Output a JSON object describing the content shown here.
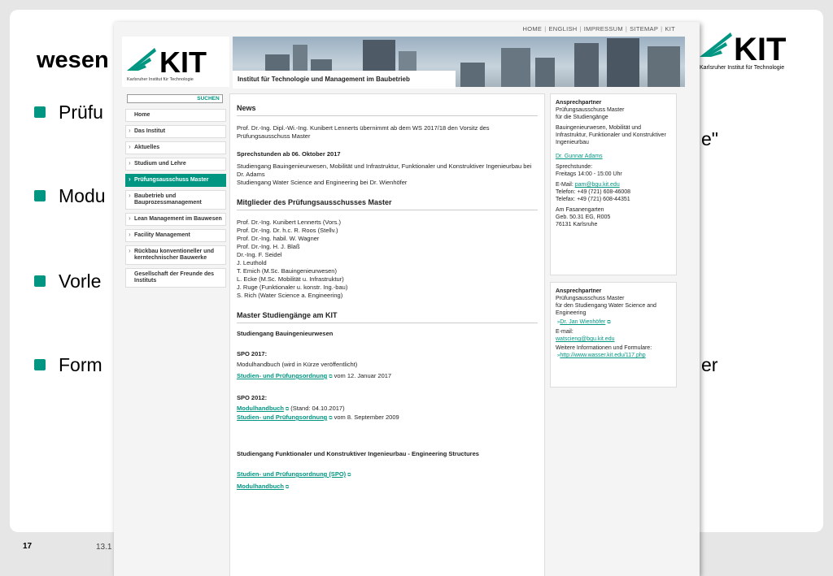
{
  "slide": {
    "title": "wesen",
    "bullets": [
      "Prüfu",
      "Modu",
      "Vorle",
      "Form"
    ],
    "fragments": [
      "e\"",
      "er"
    ],
    "page_number": "17",
    "date": "13.1"
  },
  "colors": {
    "accent": "#009682",
    "link": "#009682"
  },
  "site": {
    "topnav": [
      "HOME",
      "ENGLISH",
      "IMPRESSUM",
      "SITEMAP",
      "KIT"
    ],
    "logo_subtitle": "Karlsruher Institut für Technologie",
    "institute": "Institut für Technologie und Management im Baubetrieb",
    "search_button": "SUCHEN",
    "nav": [
      "Home",
      "Das Institut",
      "Aktuelles",
      "Studium und Lehre",
      "Prüfungsausschuss Master",
      "Baubetrieb und Bauprozessmanagement",
      "Lean Management im Bauwesen",
      "Facility Management",
      "Rückbau konventioneller und kerntechnischer Bauwerke",
      "Gesellschaft der Freunde des Instituts"
    ],
    "main": {
      "news_heading": "News",
      "news_text": "Prof. Dr.-Ing. Dipl.-Wi.-Ing. Kunibert Lennerts übernimmt ab dem WS 2017/18 den Vorsitz des Prüfungsausschuss Master",
      "office_heading": "Sprechstunden ab 06. Oktober 2017",
      "office_text_1": "Studiengang Bauingenieurwesen, Mobilität und Infrastruktur, Funktionaler und Konstruktiver Ingenieurbau bei Dr. Adams",
      "office_text_2": "Studiengang Water Science and Engineering bei Dr. Wienhöfer",
      "members_heading": "Mitglieder des Prüfungsausschusses Master",
      "members": [
        "Prof. Dr.-Ing. Kunibert Lennerts (Vors.)",
        "Prof. Dr.-Ing. Dr. h.c. R. Roos (Stellv.)",
        "Prof. Dr.-Ing. habil. W. Wagner",
        "Prof. Dr.-Ing. H. J. Blaß",
        "Dr.-Ing. F. Seidel",
        "J. Leuthold",
        "T. Emich (M.Sc. Bauingenieurwesen)",
        "L. Ecke (M.Sc. Mobilität u. Infrastruktur)",
        "J. Ruge (Funktionaler u. konstr. Ing.-bau)",
        "S. Rich (Water Science a. Engineering)"
      ],
      "programs_heading": "Master Studiengänge am KIT",
      "program_1": "Studiengang Bauingenieurwesen",
      "spo2017_heading": "SPO 2017:",
      "spo2017_text": "Modulhandbuch (wird in Kürze veröffentlicht)",
      "spo2017_link": "Studien- und Prüfungsordnung",
      "spo2017_after": "vom 12. Januar 2017",
      "spo2012_heading": "SPO 2012:",
      "spo2012_link_1": "Modulhandbuch",
      "spo2012_after_1": "(Stand: 04.10.2017)",
      "spo2012_link_2": "Studien- und Prüfungsordnung",
      "spo2012_after_2": "vom 8. September 2009",
      "program_2": "Studiengang Funktionaler und Konstruktiver Ingenieurbau - Engineering Structures",
      "program_2_link_1": "Studien- und Prüfungsordnung (SPO)",
      "program_2_link_2": "Modulhandbuch"
    },
    "contact_1": {
      "title": "Ansprechpartner",
      "line1": "Prüfungsausschuss Master",
      "line2": "für die Studiengänge",
      "programs": "Bauingenieurwesen, Mobilität und Infrastruktur, Funktionaler und Konstruktiver Ingenieurbau",
      "person": "Dr. Gunnar Adams",
      "hours_label": "Sprechstunde:",
      "hours": "Freitags 14:00 - 15:00 Uhr",
      "email_label": "E-Mail:",
      "email": "pam@bgu.kit.edu",
      "phone": "Telefon: +49 (721) 608-46008",
      "fax": "Telefax: +49 (721) 608-44351",
      "street": "Am Fasanengarten",
      "building": "Geb. 50.31 EG, R005",
      "city": "76131 Karlsruhe"
    },
    "contact_2": {
      "title": "Ansprechpartner",
      "line1": "Prüfungsausschuss Master",
      "line2": "für den Studiengang Water Science and Engineering",
      "person": "Dr. Jan Wienhöfer",
      "email_label": "E-mail:",
      "email": "watscieng@bgu.kit.edu",
      "more_label": "Weitere Informationen und Formulare:",
      "url": "http://www.wasser.kit.edu/117.php"
    }
  }
}
